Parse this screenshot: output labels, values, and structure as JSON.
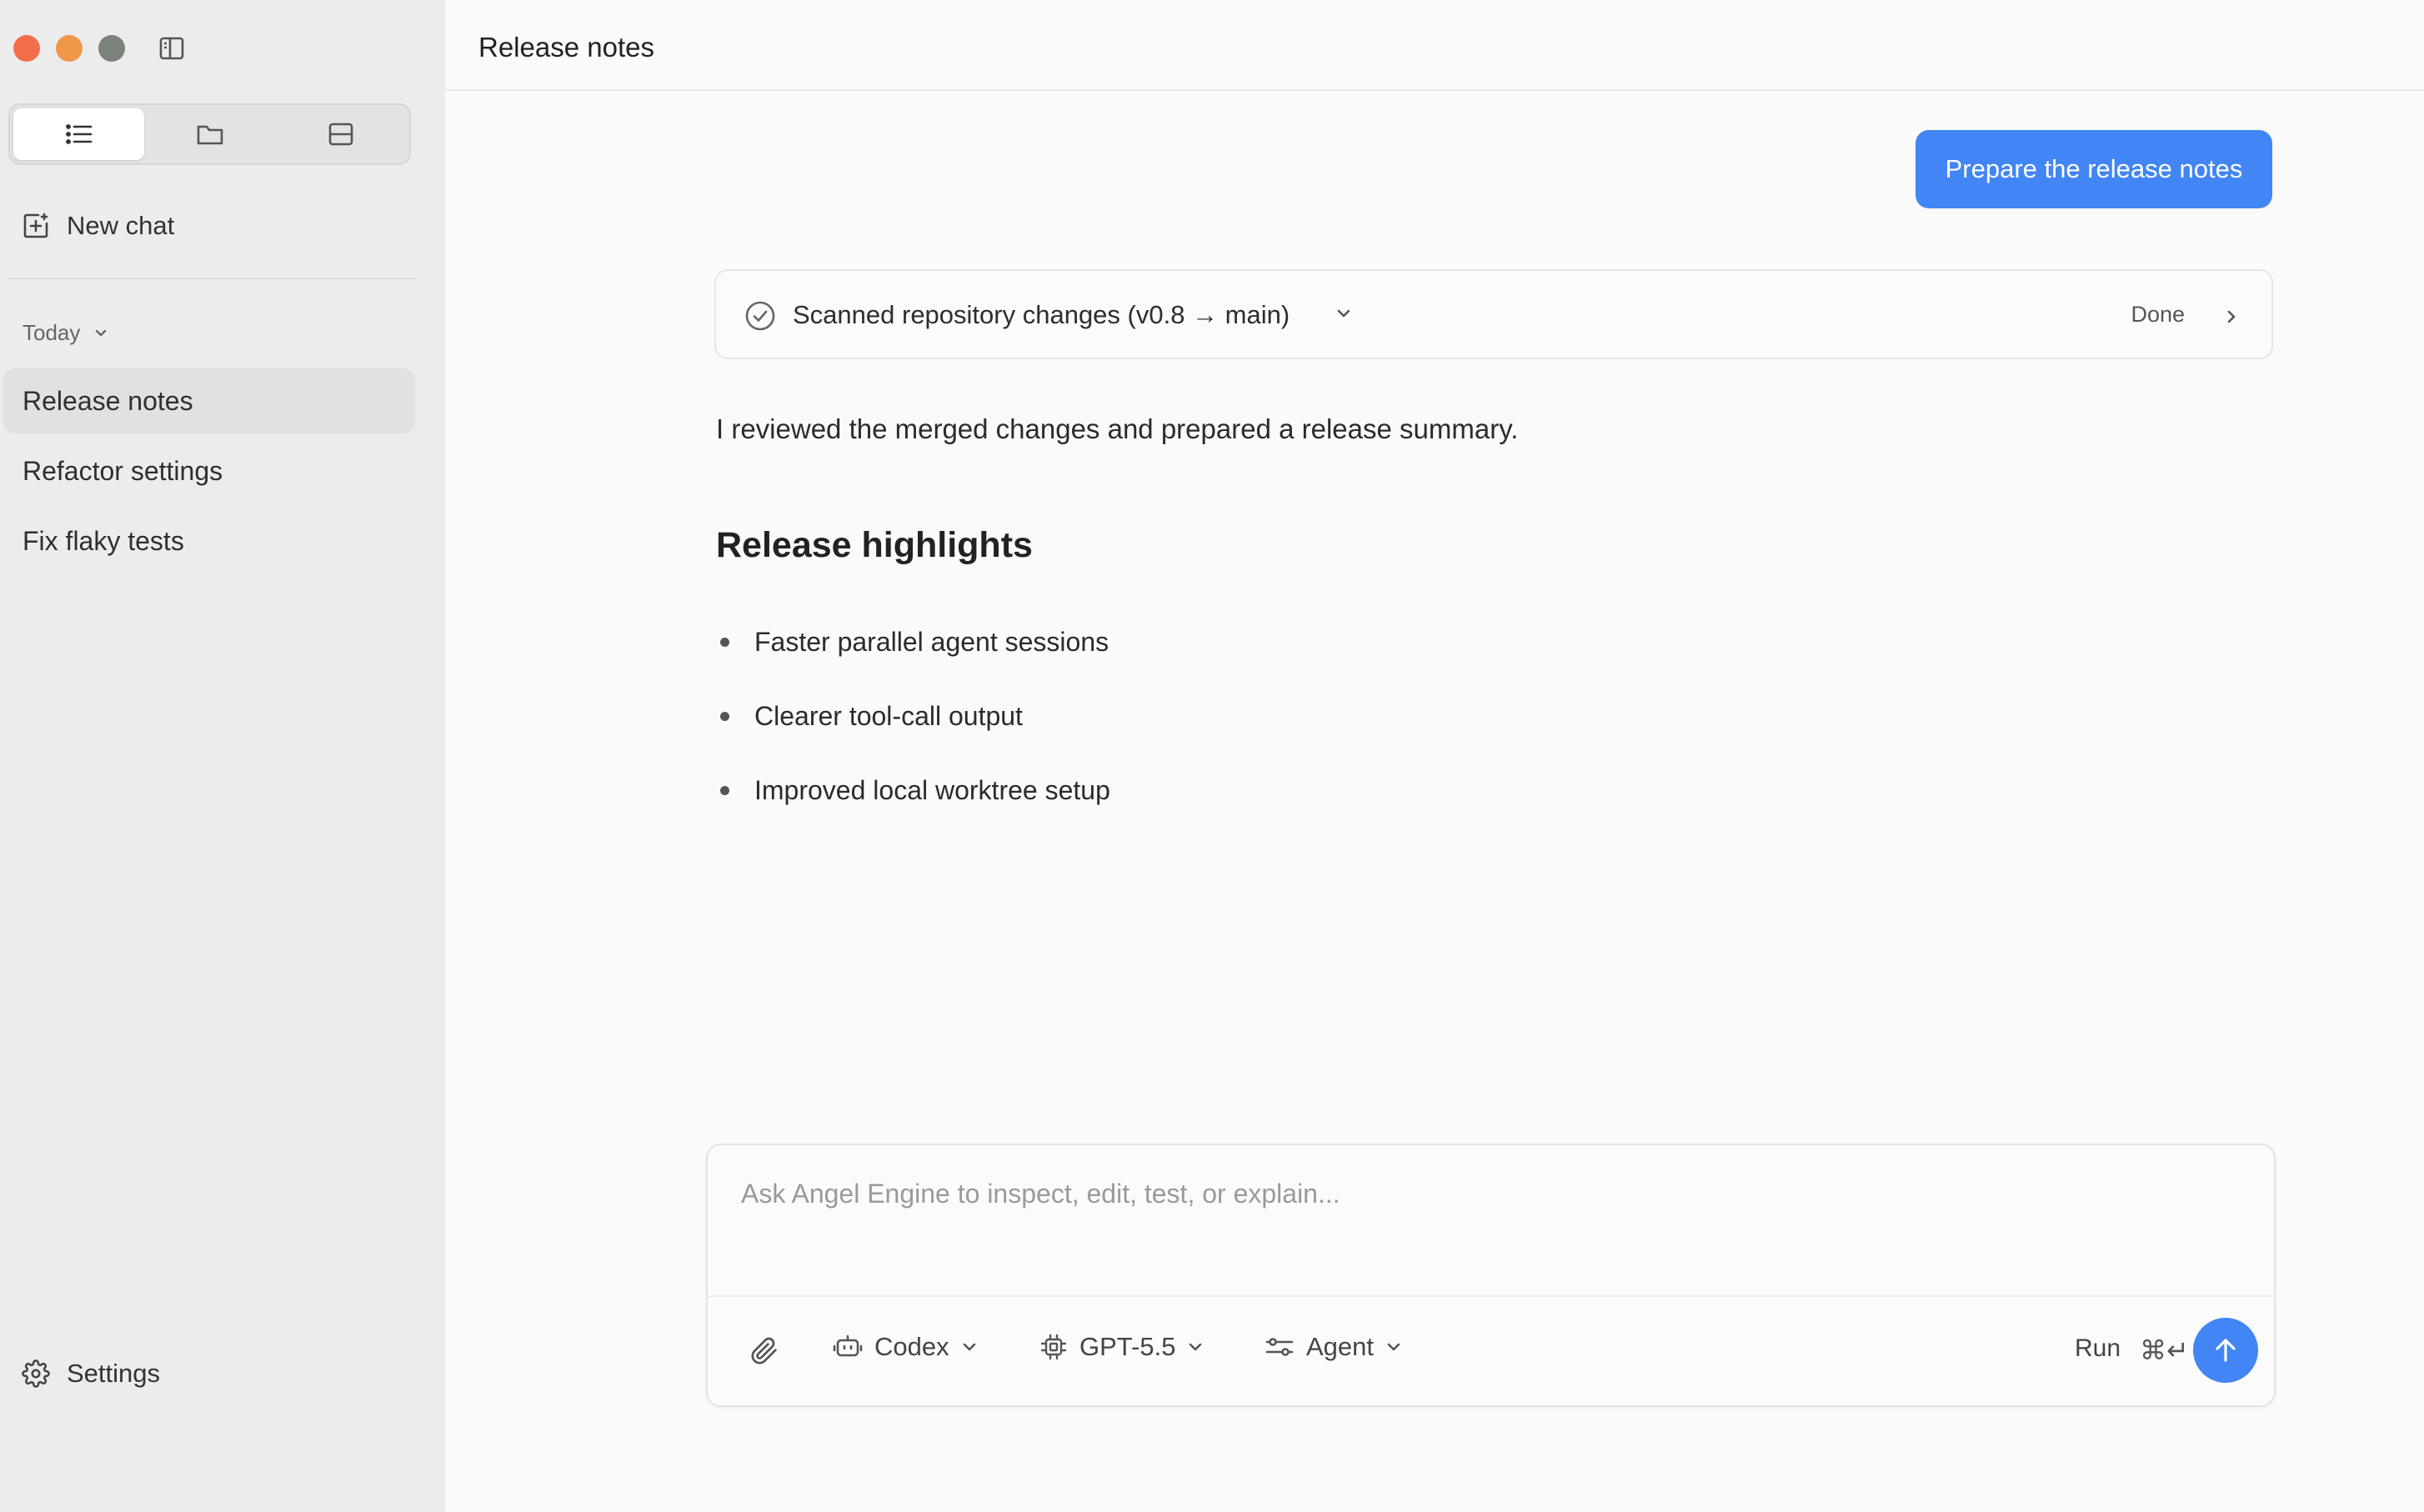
{
  "colors": {
    "accent": "#4285f4",
    "traffic_close": "#f46d4b",
    "traffic_minimize": "#f0974a",
    "traffic_zoom": "#7b8279",
    "sidebar_bg": "#ececec",
    "main_bg": "#fafafa"
  },
  "window": {
    "traffic_lights": [
      "close",
      "minimize",
      "zoom"
    ],
    "toggle_icon": "sidebar-toggle-icon"
  },
  "sidebar": {
    "view_tabs": [
      {
        "icon": "list-icon",
        "active": true
      },
      {
        "icon": "folder-icon",
        "active": false
      },
      {
        "icon": "panel-icon",
        "active": false
      }
    ],
    "new_chat": {
      "icon": "new-chat-icon",
      "label": "New chat"
    },
    "section": {
      "label": "Today",
      "icon": "chevron-down-icon"
    },
    "chats": [
      {
        "label": "Release notes",
        "active": true
      },
      {
        "label": "Refactor settings",
        "active": false
      },
      {
        "label": "Fix flaky tests",
        "active": false
      }
    ],
    "settings": {
      "icon": "gear-icon",
      "label": "Settings"
    }
  },
  "main": {
    "title": "Release notes",
    "user_message": "Prepare the release notes",
    "tool_call": {
      "icon": "check-circle-icon",
      "label": "Scanned repository changes (v0.8 → main)",
      "status": "Done"
    },
    "assistant": {
      "intro": "I reviewed the merged changes and prepared a release summary.",
      "heading": "Release highlights",
      "highlights": [
        "Faster parallel agent sessions",
        "Clearer tool-call output",
        "Improved local worktree setup"
      ]
    }
  },
  "composer": {
    "placeholder": "Ask Angel Engine to inspect, edit, test, or explain...",
    "value": "",
    "attach_icon": "paperclip-icon",
    "agent_picker": {
      "icon": "robot-icon",
      "label": "Codex"
    },
    "model_picker": {
      "icon": "chip-icon",
      "label": "GPT-5.5"
    },
    "mode_picker": {
      "icon": "sliders-icon",
      "label": "Agent"
    },
    "run_label": "Run",
    "run_shortcut": "⌘↵",
    "send_icon": "arrow-up-icon"
  }
}
